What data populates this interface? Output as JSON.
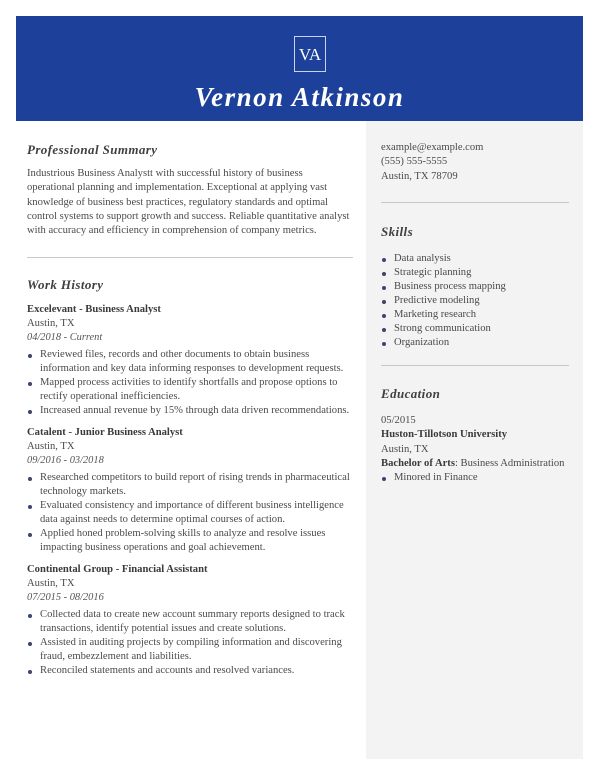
{
  "header": {
    "monogram": "VA",
    "name": "Vernon Atkinson",
    "accent_color": "#1d409a"
  },
  "summary": {
    "title": "Professional Summary",
    "text": "Industrious Business Analystt with successful history of business operational planning and implementation. Exceptional at applying vast knowledge of business best practices, regulatory standards and optimal control systems to support growth and success. Reliable quantitative analyst with accuracy and efficiency in comprehension of company metrics."
  },
  "work": {
    "title": "Work History",
    "jobs": [
      {
        "title": "Excelevant - Business Analyst",
        "location": "Austin, TX",
        "dates": "04/2018 - Current",
        "bullets": [
          "Reviewed files, records and other documents to obtain business information and key data informing responses to development requests.",
          "Mapped process activities to identify shortfalls and propose options to rectify operational inefficiencies.",
          "Increased annual revenue by 15% through data driven recommendations."
        ]
      },
      {
        "title": "Catalent - Junior Business Analyst",
        "location": "Austin, TX",
        "dates": "09/2016 - 03/2018",
        "bullets": [
          "Researched competitors to build report of rising trends in pharmaceutical technology markets.",
          "Evaluated consistency and importance of different business intelligence data against needs to determine optimal courses of action.",
          "Applied honed problem-solving skills to analyze and resolve issues impacting business operations and goal achievement."
        ]
      },
      {
        "title": "Continental Group - Financial Assistant",
        "location": "Austin, TX",
        "dates": "07/2015 - 08/2016",
        "bullets": [
          "Collected data to create new account summary reports designed to track transactions, identify potential issues and create solutions.",
          "Assisted in auditing projects by compiling information and discovering fraud, embezzlement and liabilities.",
          "Reconciled statements and accounts and resolved variances."
        ]
      }
    ]
  },
  "contact": {
    "email": "example@example.com",
    "phone": "(555) 555-5555",
    "address": "Austin, TX 78709"
  },
  "skills": {
    "title": "Skills",
    "items": [
      "Data analysis",
      "Strategic planning",
      "Business process mapping",
      "Predictive modeling",
      "Marketing research",
      "Strong communication",
      "Organization"
    ]
  },
  "education": {
    "title": "Education",
    "date": "05/2015",
    "school": "Huston-Tillotson University",
    "location": "Austin, TX",
    "degree": "Bachelor of Arts",
    "field": ": Business Administration",
    "bullets": [
      "Minored in Finance"
    ]
  }
}
